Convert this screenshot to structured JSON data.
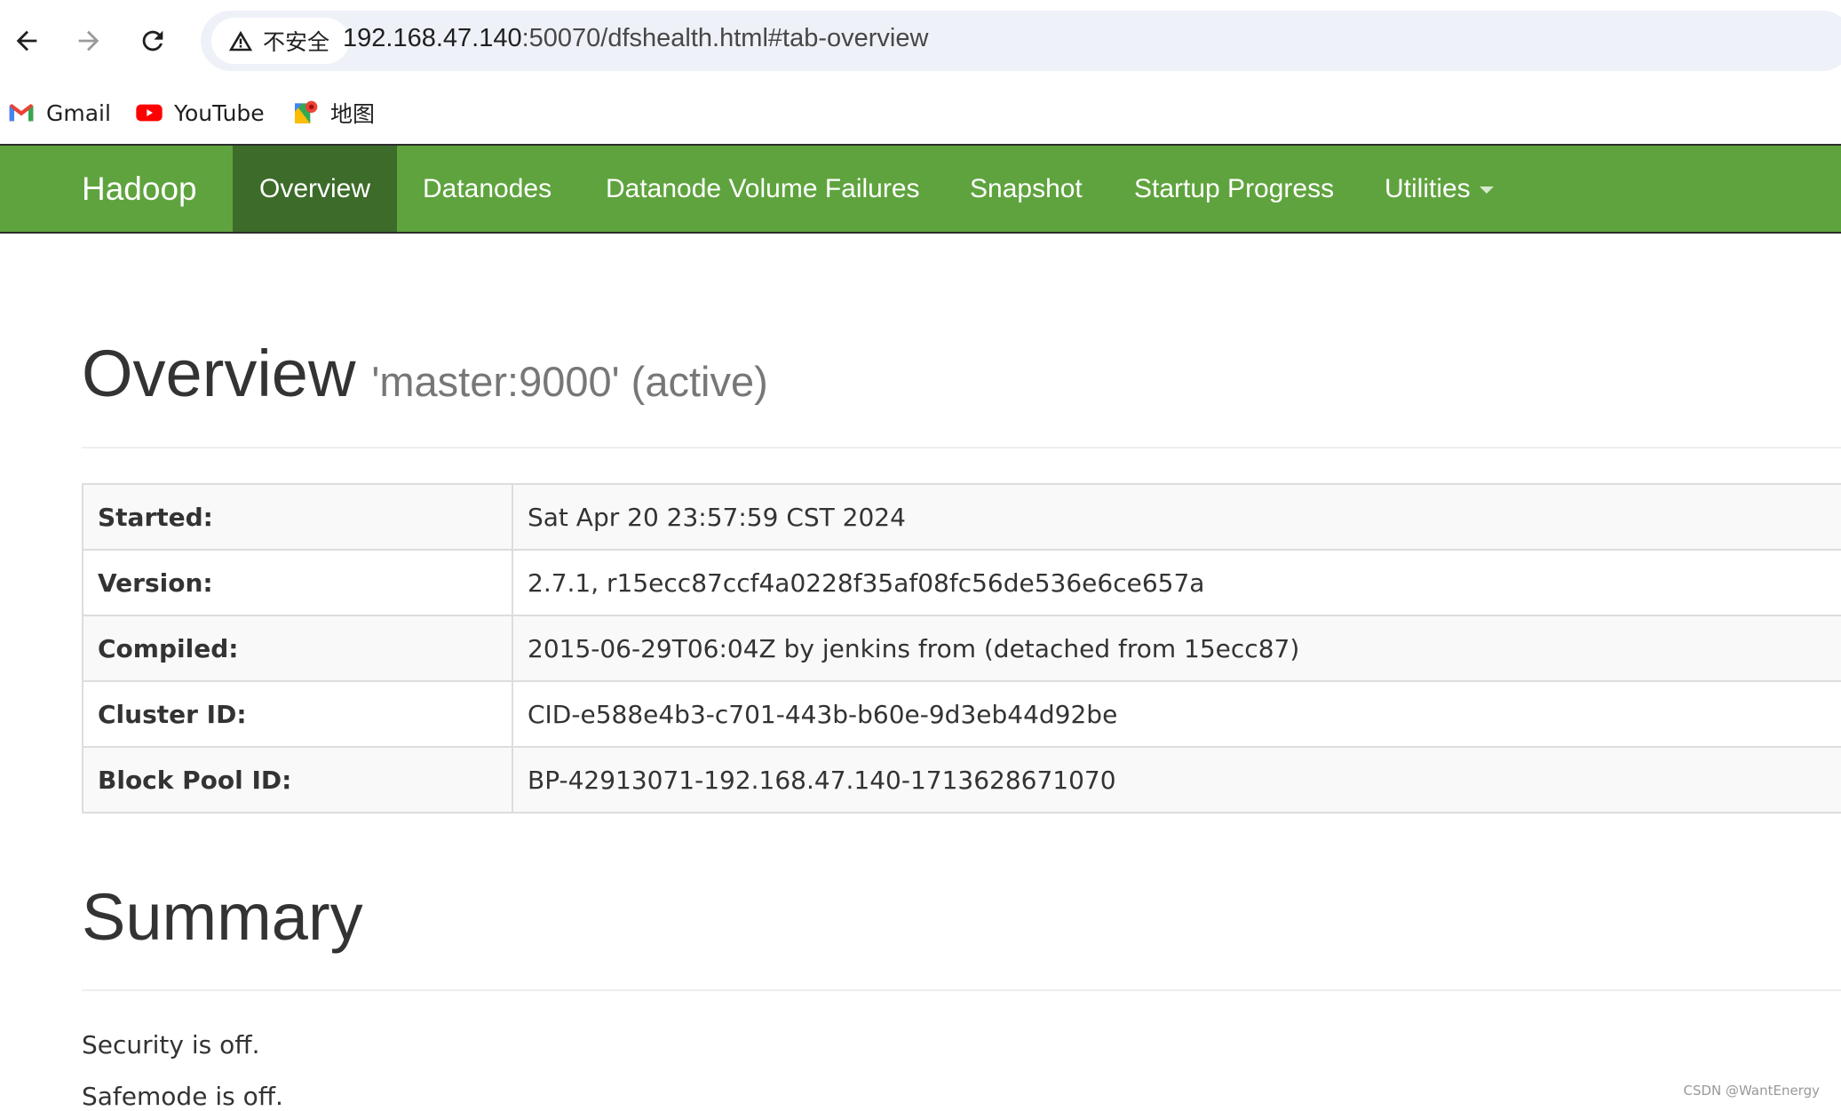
{
  "browser": {
    "security_label": "不安全",
    "url_host": "192.168.47.140",
    "url_path": ":50070/dfshealth.html#tab-overview",
    "bookmarks": [
      {
        "label": "Gmail",
        "icon": "gmail-icon"
      },
      {
        "label": "YouTube",
        "icon": "youtube-icon"
      },
      {
        "label": "地图",
        "icon": "maps-icon"
      }
    ]
  },
  "navbar": {
    "brand": "Hadoop",
    "items": [
      "Overview",
      "Datanodes",
      "Datanode Volume Failures",
      "Snapshot",
      "Startup Progress",
      "Utilities"
    ],
    "active": "Overview",
    "color": "#5fa33e",
    "active_color": "#3d6b2a"
  },
  "overview": {
    "title": "Overview",
    "subtitle": "'master:9000' (active)",
    "rows": [
      {
        "key": "Started:",
        "value": "Sat Apr 20 23:57:59 CST 2024"
      },
      {
        "key": "Version:",
        "value": "2.7.1, r15ecc87ccf4a0228f35af08fc56de536e6ce657a"
      },
      {
        "key": "Compiled:",
        "value": "2015-06-29T06:04Z by jenkins from (detached from 15ecc87)"
      },
      {
        "key": "Cluster ID:",
        "value": "CID-e588e4b3-c701-443b-b60e-9d3eb44d92be"
      },
      {
        "key": "Block Pool ID:",
        "value": "BP-42913071-192.168.47.140-1713628671070"
      }
    ]
  },
  "summary": {
    "title": "Summary",
    "security": "Security is off.",
    "safemode": "Safemode is off."
  },
  "watermark": "CSDN @WantEnergy"
}
